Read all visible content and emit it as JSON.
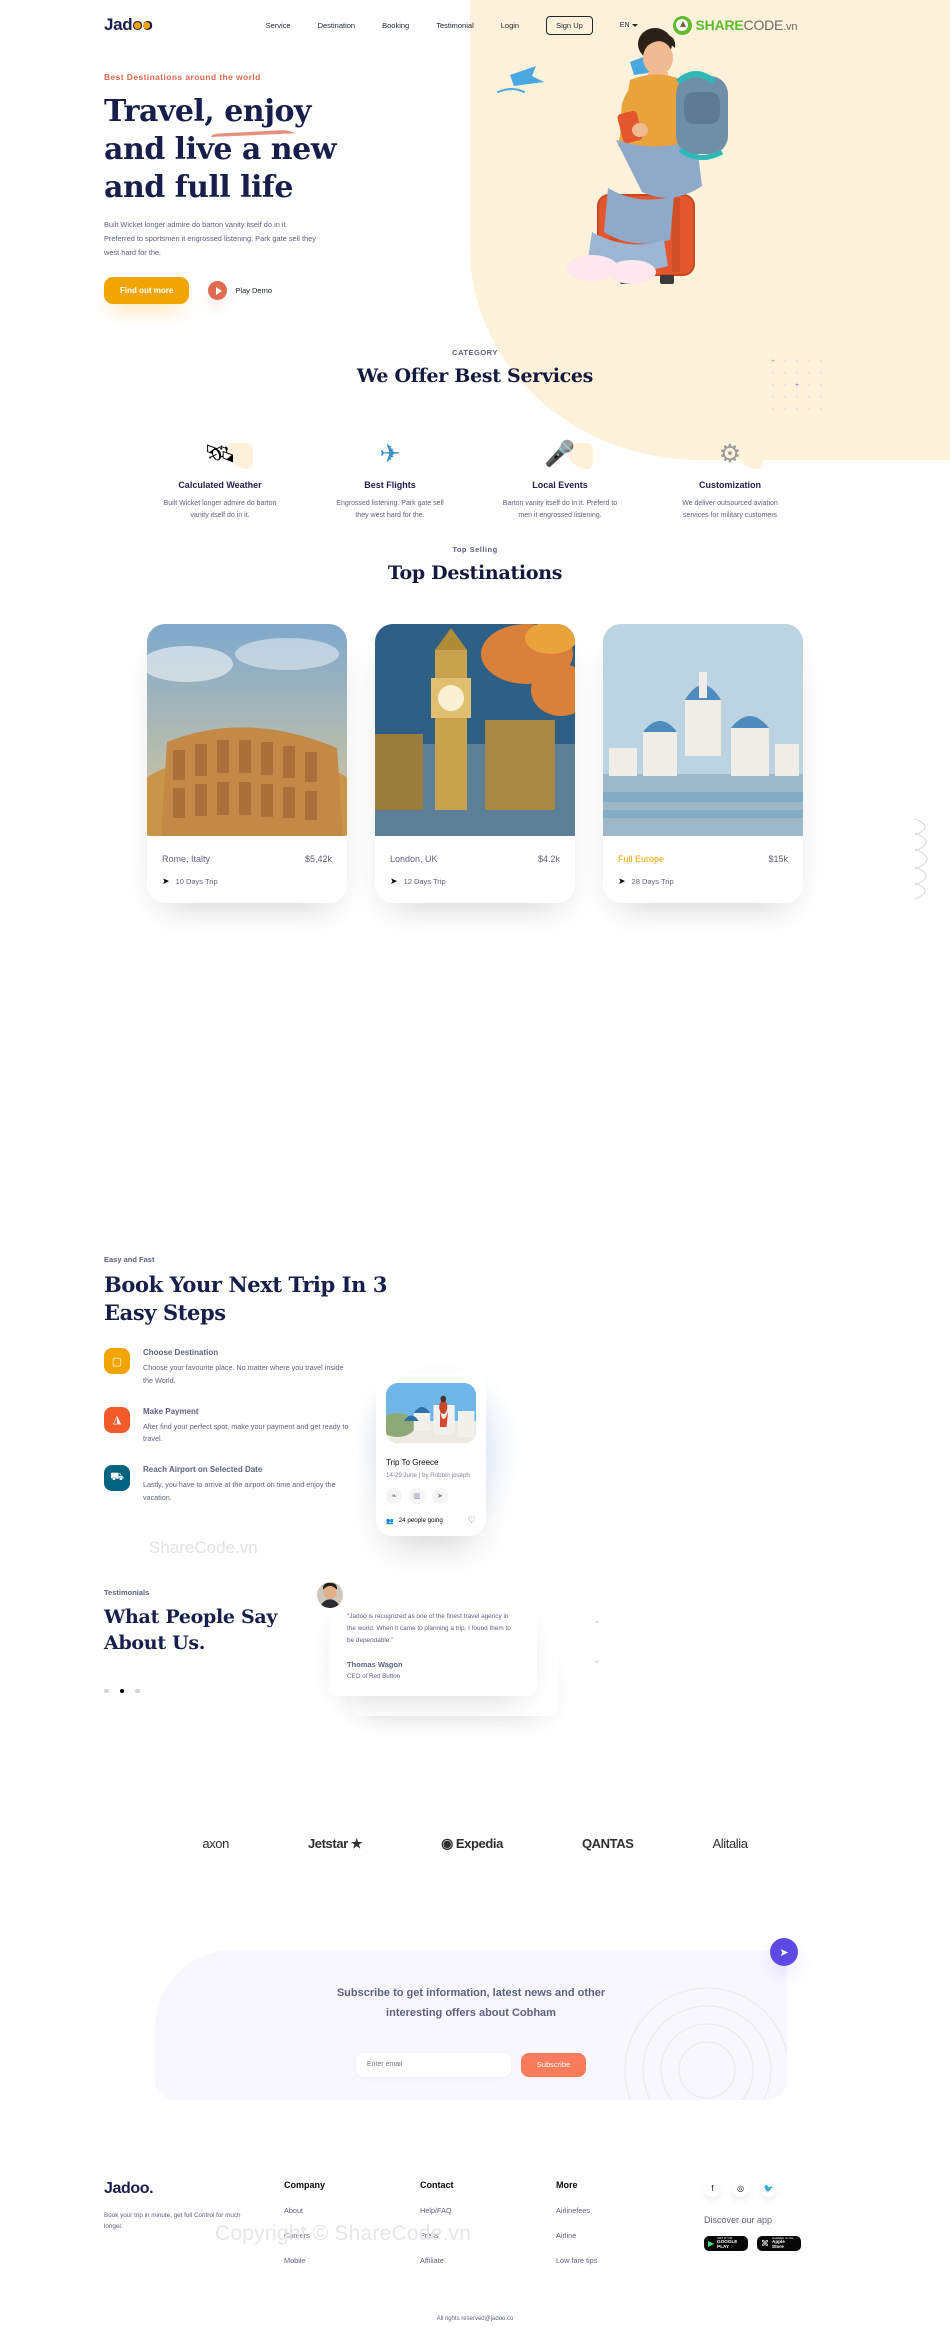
{
  "nav": {
    "logo": "Jadoo",
    "links": [
      "Service",
      "Destination",
      "Booking",
      "Testimonial",
      "Login"
    ],
    "signup_label": "Sign Up",
    "lang": "EN",
    "watermark": {
      "share": "SHARE",
      "code": "CODE",
      "vn": ".vn"
    }
  },
  "hero": {
    "kicker": "Best Destinations around the world",
    "title_line1": "Travel, enjoy",
    "title_line2": "and live a new",
    "title_line3": "and full life",
    "desc": "Built Wicket longer admire do barton vanity itself do in it. Preferred to sportsmen it engrossed listening. Park gate sell they west hard for the.",
    "cta_primary": "Find out more",
    "play_label": "Play Demo"
  },
  "services": {
    "kicker": "CATEGORY",
    "title": "We Offer Best Services",
    "items": [
      {
        "icon": "weather-icon",
        "glyph": "🛰",
        "name": "Calculated Weather",
        "desc": "Built Wicket longer admire do barton vanity itself do in it."
      },
      {
        "icon": "flight-icon",
        "glyph": "✈",
        "name": "Best Flights",
        "desc": "Engrossed listening. Park gate sell they west hard for the."
      },
      {
        "icon": "microphone-icon",
        "glyph": "🎤",
        "name": "Local Events",
        "desc": "Barton vanity itself do in it. Preferd to men it engrossed listening."
      },
      {
        "icon": "gear-icon",
        "glyph": "⚙",
        "name": "Customization",
        "desc": "We deliver outsourced aviation services for military customers"
      }
    ]
  },
  "destinations": {
    "kicker": "Top Selling",
    "title": "Top Destinations",
    "cards": [
      {
        "name": "Rome, Italty",
        "price": "$5,42k",
        "trip": "10 Days Trip",
        "highlight": false
      },
      {
        "name": "London, UK",
        "price": "$4.2k",
        "trip": "12 Days Trip",
        "highlight": false
      },
      {
        "name": "Full Europe",
        "price": "$15k",
        "trip": "28 Days Trip",
        "highlight": true
      }
    ]
  },
  "booking": {
    "kicker": "Easy and Fast",
    "title_line1": "Book Your Next Trip In 3",
    "title_line2": "Easy Steps",
    "steps": [
      {
        "icon": "destination-icon",
        "color": "#F1A501",
        "title": "Choose Destination",
        "desc": "Choose your favourite place. No matter where you travel inside the World."
      },
      {
        "icon": "payment-icon",
        "color": "#F15A2B",
        "title": "Make Payment",
        "desc": "After find your perfect spot, make your payment and get ready to travel."
      },
      {
        "icon": "airport-icon",
        "color": "#006380",
        "title": "Reach Airport on Selected Date",
        "desc": "Lastly, you have to arrive at the airport on time and enjoy the vacation."
      }
    ],
    "trip_card": {
      "title": "Trip To Greece",
      "meta": "14-29 June | by Robbin joseph",
      "icons": [
        "leaf-icon",
        "map-icon",
        "send-icon"
      ],
      "going": "24 people going",
      "favorite": "heart-icon"
    },
    "watermark": "ShareCode.vn"
  },
  "testimonials": {
    "kicker": "Testimonials",
    "title_line1": "What People Say",
    "title_line2": "About Us.",
    "quote": "\"Jadoo is recognized as one of the finest travel agency in the world. When it came to planning a trip, I found them to be dependable.\"",
    "name": "Thomas Wagon",
    "role": "CEO of Red Button",
    "dots": [
      false,
      true,
      false
    ]
  },
  "brands": [
    "axon",
    "Jetstar",
    "Expedia",
    "QANTAS",
    "Alitalia"
  ],
  "subscribe": {
    "head_line1": "Subscribe to get information, latest news and other",
    "head_line2": "interesting offers about Cobham",
    "placeholder": "Enter email",
    "button": "Subscribe",
    "fab": "send-icon"
  },
  "footer": {
    "logo": "Jadoo.",
    "tagline": "Book your trip in minute, get full Control for much longer.",
    "columns": [
      {
        "heading": "Company",
        "links": [
          "About",
          "Careers",
          "Mobile"
        ]
      },
      {
        "heading": "Contact",
        "links": [
          "Help/FAQ",
          "Press",
          "Affiliate"
        ]
      },
      {
        "heading": "More",
        "links": [
          "Airlinefees",
          "Airline",
          "Low fare tips"
        ]
      }
    ],
    "socials": [
      "facebook-icon",
      "instagram-icon",
      "twitter-icon"
    ],
    "discover": "Discover our app",
    "stores": [
      {
        "small": "GET IT ON",
        "big": "GOOGLE PLAY"
      },
      {
        "small": "Available on the",
        "big": "Apple Store"
      }
    ],
    "copyright": "All rights reserved@jadoo.co",
    "watermark": "Copyright © ShareCode.vn"
  },
  "colors": {
    "navy": "#181E4B",
    "orange": "#DF6951",
    "gold": "#F1A501",
    "muted": "#5E6282",
    "cream": "#FFF1DA",
    "purple": "#5C4AE4"
  }
}
